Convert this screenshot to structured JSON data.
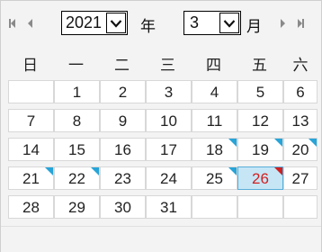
{
  "header": {
    "prev_icon": "double-left-arrow-icon",
    "next_icon": "double-right-arrow-icon",
    "year_value": "2021",
    "year_label": "年",
    "month_value": "3",
    "month_label": "月"
  },
  "weekdays": [
    "日",
    "一",
    "二",
    "三",
    "四",
    "五",
    "六"
  ],
  "colors": {
    "marker_blue": "#27a4d8",
    "marker_red": "#d21f1f",
    "today_bg": "#c6e6f6",
    "today_text": "#d21f1f"
  },
  "grid": {
    "rows": [
      [
        "",
        "1",
        "2",
        "3",
        "4",
        "5",
        "6"
      ],
      [
        "7",
        "8",
        "9",
        "10",
        "11",
        "12",
        "13"
      ],
      [
        "14",
        "15",
        "16",
        "17",
        "18",
        "19",
        "20"
      ],
      [
        "21",
        "22",
        "23",
        "24",
        "25",
        "26",
        "27"
      ],
      [
        "28",
        "29",
        "30",
        "31",
        "",
        "",
        ""
      ]
    ],
    "marked_blue": [
      "18",
      "19",
      "20",
      "21",
      "22",
      "25"
    ],
    "marked_red": [
      "26"
    ],
    "today": "26"
  }
}
